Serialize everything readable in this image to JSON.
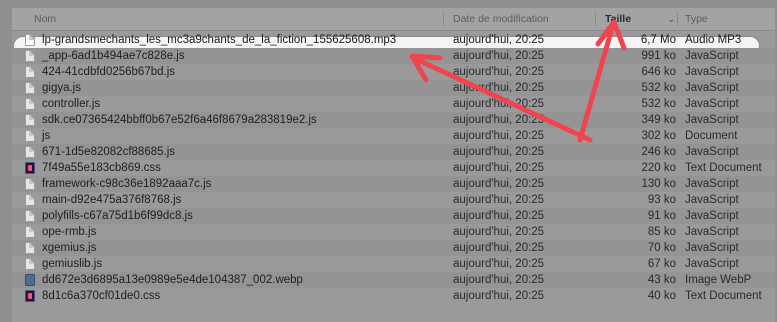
{
  "columns": {
    "name": "Nom",
    "date": "Date de modification",
    "size": "Taille",
    "type": "Type"
  },
  "size_sort_icon": "chevron-down-icon",
  "rows": [
    {
      "name": "lp-grandsmechants_les_mc3a9chants_de_la_fiction_155625608.mp3",
      "date": "aujourd'hui, 20:25",
      "size": "6,7 Mo",
      "type": "Audio MP3",
      "icon": "audio-file-icon"
    },
    {
      "name": "_app-6ad1b494ae7c828e.js",
      "date": "aujourd'hui, 20:25",
      "size": "991 ko",
      "type": "JavaScript",
      "icon": "js-file-icon"
    },
    {
      "name": "424-41cdbfd0256b67bd.js",
      "date": "aujourd'hui, 20:25",
      "size": "646 ko",
      "type": "JavaScript",
      "icon": "js-file-icon"
    },
    {
      "name": "gigya.js",
      "date": "aujourd'hui, 20:25",
      "size": "532 ko",
      "type": "JavaScript",
      "icon": "js-file-icon"
    },
    {
      "name": "controller.js",
      "date": "aujourd'hui, 20:25",
      "size": "532 ko",
      "type": "JavaScript",
      "icon": "js-file-icon"
    },
    {
      "name": "sdk.ce07365424bbff0b67e52f6a46f8679a283819e2.js",
      "date": "aujourd'hui, 20:25",
      "size": "349 ko",
      "type": "JavaScript",
      "icon": "js-file-icon"
    },
    {
      "name": "js",
      "date": "aujourd'hui, 20:25",
      "size": "302 ko",
      "type": "Document",
      "icon": "document-file-icon"
    },
    {
      "name": "671-1d5e82082cf88685.js",
      "date": "aujourd'hui, 20:25",
      "size": "246 ko",
      "type": "JavaScript",
      "icon": "js-file-icon"
    },
    {
      "name": "7f49a55e183cb869.css",
      "date": "aujourd'hui, 20:25",
      "size": "220 ko",
      "type": "Text Document",
      "icon": "css-file-icon"
    },
    {
      "name": "framework-c98c36e1892aaa7c.js",
      "date": "aujourd'hui, 20:25",
      "size": "130 ko",
      "type": "JavaScript",
      "icon": "js-file-icon"
    },
    {
      "name": "main-d92e475a376f8768.js",
      "date": "aujourd'hui, 20:25",
      "size": "93 ko",
      "type": "JavaScript",
      "icon": "js-file-icon"
    },
    {
      "name": "polyfills-c67a75d1b6f99dc8.js",
      "date": "aujourd'hui, 20:25",
      "size": "91 ko",
      "type": "JavaScript",
      "icon": "js-file-icon"
    },
    {
      "name": "ope-rmb.js",
      "date": "aujourd'hui, 20:25",
      "size": "85 ko",
      "type": "JavaScript",
      "icon": "js-file-icon"
    },
    {
      "name": "xgemius.js",
      "date": "aujourd'hui, 20:25",
      "size": "70 ko",
      "type": "JavaScript",
      "icon": "js-file-icon"
    },
    {
      "name": "gemiuslib.js",
      "date": "aujourd'hui, 20:25",
      "size": "67 ko",
      "type": "JavaScript",
      "icon": "js-file-icon"
    },
    {
      "name": "dd672e3d6895a13e0989e5e4de104387_002.webp",
      "date": "aujourd'hui, 20:25",
      "size": "43 ko",
      "type": "Image WebP",
      "icon": "image-file-icon"
    },
    {
      "name": "8d1c6a370cf01de0.css",
      "date": "aujourd'hui, 20:25",
      "size": "40 ko",
      "type": "Text Document",
      "icon": "css-file-icon"
    }
  ],
  "selected_index": 0,
  "annotation_color": "#f0454e"
}
